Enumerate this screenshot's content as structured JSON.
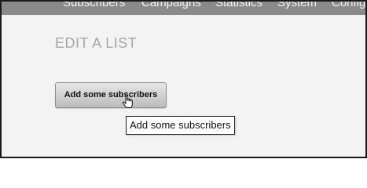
{
  "nav": {
    "items": [
      "Subscribers",
      "Campaigns",
      "Statistics",
      "System",
      "Config"
    ]
  },
  "page": {
    "title": "EDIT A LIST"
  },
  "actions": {
    "add_subscribers_label": "Add some subscribers"
  },
  "tooltip": {
    "text": "Add some subscribers"
  },
  "icons": {
    "cursor": "hand-pointer-icon"
  }
}
